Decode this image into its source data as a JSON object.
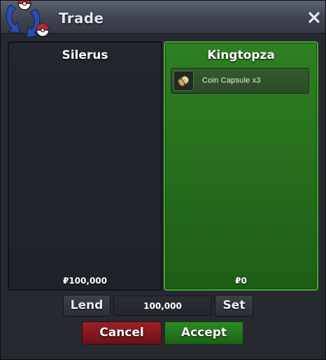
{
  "window": {
    "title": "Trade",
    "icons": {
      "logo": "trade-exchange-logo",
      "close": "close-icon"
    }
  },
  "left_panel": {
    "player_name": "Silerus",
    "money": "₽100,000"
  },
  "right_panel": {
    "player_name": "Kingtopza",
    "money": "₽0",
    "items": [
      {
        "label": "Coin Capsule  x3",
        "icon": "coin-capsule-icon"
      }
    ]
  },
  "controls": {
    "lend_label": "Lend",
    "amount_value": "100,000",
    "set_label": "Set",
    "cancel_label": "Cancel",
    "accept_label": "Accept"
  },
  "colors": {
    "accepted_panel": "#2f7f23",
    "accepted_border": "#45a832",
    "cancel": "#9a2028",
    "accept": "#2d8a24",
    "logo_blue": "#2a4fb0",
    "logo_red": "#c62430"
  }
}
